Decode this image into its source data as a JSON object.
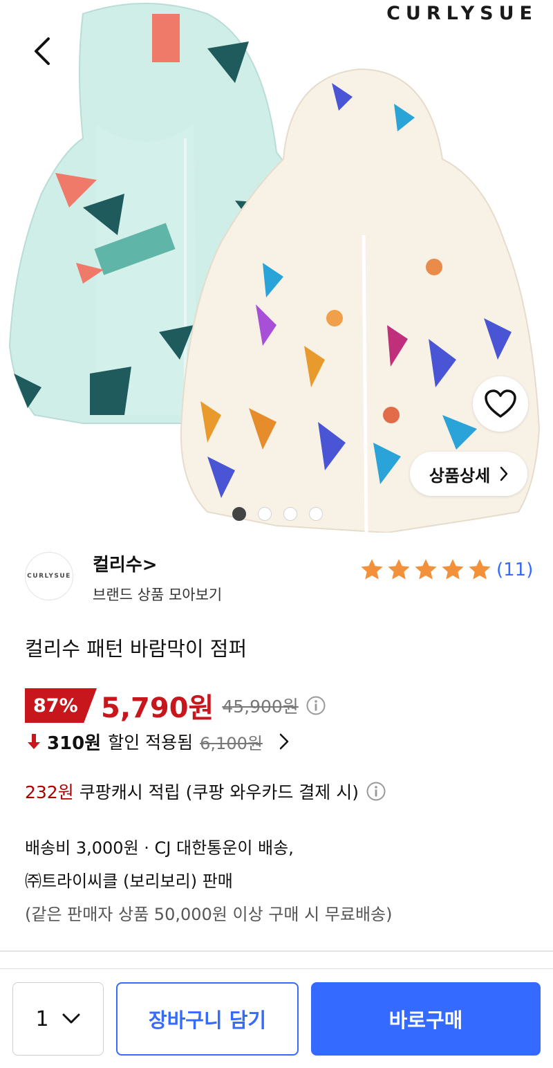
{
  "hero": {
    "brand_wordmark": "CURLYSUE",
    "image_alt": "product photo",
    "detail_button_label": "상품상세",
    "carousel_pages": 4,
    "carousel_active_index": 0
  },
  "icons": {
    "back": "chevron-left-icon",
    "wishlist": "heart-icon",
    "detail": "chevron-right-icon",
    "rating_star": "star-icon",
    "info": "info-circle-icon",
    "down_arrow": "arrow-down-icon",
    "qty_dropdown": "chevron-down-icon"
  },
  "brand": {
    "logo_text": "CURLYSUE",
    "name": "컬리수>",
    "subtitle": "브랜드 상품 모아보기"
  },
  "rating": {
    "stars": 5,
    "count_label": "(11)"
  },
  "product": {
    "title": "컬리수 패턴 바람막이 점퍼",
    "discount_rate": "87%",
    "sale_price": "5,790원",
    "original_price": "45,900원",
    "coupon_amount": "310원",
    "coupon_text": "할인 적용됨",
    "coupon_original_price": "6,100원",
    "cash_amount": "232원",
    "cash_text": "쿠팡캐시 적립 (쿠팡 와우카드 결제 시)"
  },
  "shipping": {
    "line1": "배송비 3,000원 · CJ 대한통운이 배송,",
    "line2": "㈜트라이씨클 (보리보리) 판매",
    "line3": "(같은 판매자 상품 50,000원 이상 구매 시 무료배송)"
  },
  "bottom_bar": {
    "quantity": "1",
    "cart_label": "장바구니 담기",
    "buy_label": "바로구매"
  },
  "colors": {
    "accent_blue": "#346aff",
    "sale_red": "#c8161d",
    "cash_red": "#ae0000",
    "star_orange": "#f2913a"
  }
}
